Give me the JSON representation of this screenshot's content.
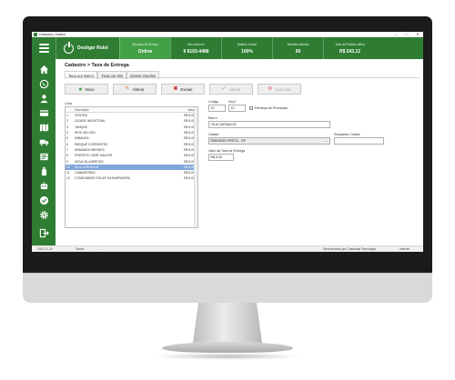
{
  "window": {
    "title": "Datacasa Chatbot",
    "controls": [
      "–",
      "□",
      "✕"
    ]
  },
  "header": {
    "power_label": "Desligar Robô",
    "stats": [
      {
        "label": "Situação do Serviço",
        "value": "Online",
        "highlight": true
      },
      {
        "label": "Meu Número",
        "value": "9 8193-4488"
      },
      {
        "label": "Bateria Celular",
        "value": "100%"
      },
      {
        "label": "Sessões Abertas",
        "value": "00"
      },
      {
        "label": "Total de Pedidos (Mês)",
        "value": "R$ 543,12"
      }
    ]
  },
  "sidebar": {
    "icons": [
      "home-icon",
      "whatsapp-icon",
      "user-icon",
      "card-icon",
      "map-icon",
      "truck-icon",
      "settings-icon",
      "bottle-icon",
      "robot-icon",
      "check-icon",
      "gear-icon"
    ],
    "exit_icon": "exit-icon"
  },
  "page": {
    "breadcrumb": "Cadastro > Taxa de Entrega",
    "tabs": [
      "Taxa por Bairro",
      "Taxa por KM",
      "Outras Opções"
    ],
    "active_tab": 0
  },
  "toolbar": {
    "new_label": "Novo",
    "edit_label": "Alterar",
    "delete_label": "Excluir",
    "save_label": "Salvar",
    "cancel_label": "Cancelar"
  },
  "list": {
    "label": "Lista",
    "columns": [
      "Descrição",
      "Valor"
    ],
    "rows": [
      {
        "id": "1",
        "desc": "CENTRO",
        "value": "R$ 5,00"
      },
      {
        "id": "2",
        "desc": "CIDADE INDUSTRIAL",
        "value": "R$ 5,00"
      },
      {
        "id": "3",
        "desc": "TANQUE",
        "value": "R$ 5,00"
      },
      {
        "id": "4",
        "desc": "REIS VELOSO",
        "value": "R$ 5,00"
      },
      {
        "id": "5",
        "desc": "IMBANGA",
        "value": "R$ 5,00"
      },
      {
        "id": "6",
        "desc": "PARQUE CORRENTES",
        "value": "R$ 5,00"
      },
      {
        "id": "7",
        "desc": "ARMANDO MENDES",
        "value": "R$ 5,00"
      },
      {
        "id": "8",
        "desc": "PREFEITO JOSÉ WALTER",
        "value": "R$ 5,00"
      },
      {
        "id": "9",
        "desc": "NOVA VILA BRETAS",
        "value": "R$ 5,00"
      },
      {
        "id": "10",
        "desc": "VILA CARVALHO",
        "value": "R$ 5,00"
      },
      {
        "id": "11",
        "desc": "CANAVIEIRAS",
        "value": "R$ 5,00"
      },
      {
        "id": "12",
        "desc": "CONDOMÍNIO SOLAR DA BARRAGEM",
        "value": "R$ 5,00"
      }
    ],
    "selected_index": 9
  },
  "form": {
    "codigo_label": "Código",
    "codigo_value": "10",
    "seq_label": "Seq?",
    "seq_value": "10",
    "promo_label": "Participa de Promoção",
    "bairro_label": "Bairro",
    "bairro_value": "VILA CARVALHO",
    "cidade_label": "Cidade",
    "cidade_value": "RIBEIRÃO PRETO - SP",
    "requisitar_label": "Requisitar Cidade",
    "requisitar_value": "",
    "taxa_label": "Valor da Taxa de Entrega",
    "taxa_value": "R$ 5,00"
  },
  "status": {
    "date": "2022-11-23",
    "state": "Status",
    "state_value": "...",
    "developer": "Desenvolvido por: Datacasa Tecnologia",
    "connection": "Internet"
  },
  "colors": {
    "primary": "#2e7d32",
    "highlight": "#43a047",
    "selection": "#7fa7d9"
  }
}
